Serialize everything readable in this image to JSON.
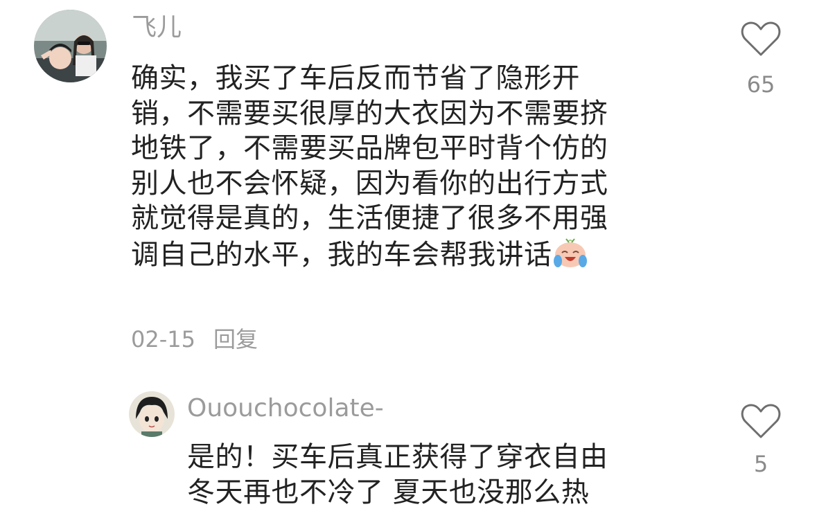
{
  "comments": [
    {
      "username": "飞儿",
      "lines": [
        "确实，我买了车后反而节省了隐形开",
        "销，不需要买很厚的大衣因为不需要挤",
        "地铁了，不需要买品牌包平时背个仿的",
        "别人也不会怀疑，因为看你的出行方式",
        "就觉得是真的，生活便捷了很多不用强",
        "调自己的水平，我的车会帮我讲话"
      ],
      "emoji": "crying-laughing-face-emoji",
      "date": "02-15",
      "reply_label": "回复",
      "like_count": "65",
      "like_icon": "heart-outline-icon"
    },
    {
      "username": "Ououchocolate-",
      "lines": [
        "是的！买车后真正获得了穿衣自由",
        "冬天再也不冷了 夏天也没那么热"
      ],
      "like_count": "5",
      "like_icon": "heart-outline-icon"
    }
  ],
  "colors": {
    "text": "#222222",
    "muted": "#9b9b9b",
    "icon": "#6e6e6e",
    "background": "#ffffff"
  }
}
